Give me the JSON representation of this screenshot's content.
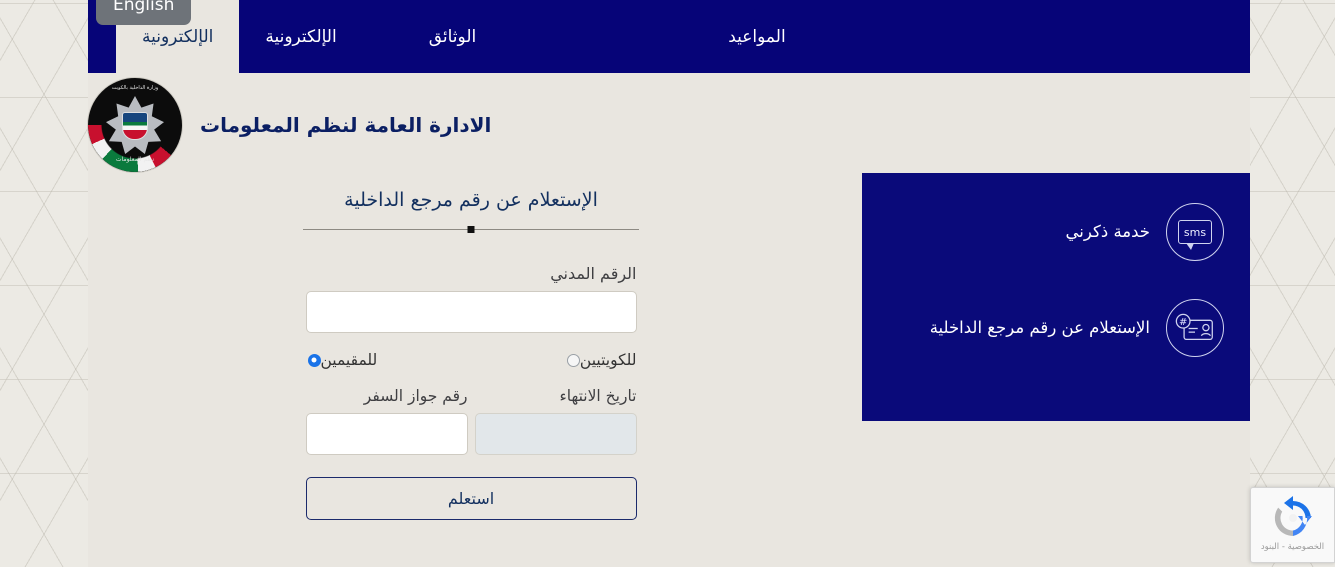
{
  "navbar": {
    "lang_button": "English",
    "items": [
      {
        "label": "الإلكترونية",
        "active": true
      },
      {
        "label": "الإلكترونية",
        "active": false
      },
      {
        "label": "الوثائق",
        "active": false
      },
      {
        "label": "المواعيد",
        "active": false
      }
    ]
  },
  "header": {
    "org_title": "الادارة العامة لنظم المعلومات",
    "emblem_top_text": "وزارة الداخلية بالكويت",
    "emblem_bottom_text": "نظم المعلومات"
  },
  "side_panel": {
    "services": [
      {
        "label": "خدمة ذكرني",
        "icon": "sms-icon",
        "icon_text": "sms"
      },
      {
        "label": "الإستعلام عن رقم مرجع الداخلية",
        "icon": "id-card-hash-icon",
        "icon_text": ""
      }
    ]
  },
  "form": {
    "title": "الإستعلام عن رقم مرجع الداخلية",
    "civil_number": {
      "label": "الرقم المدني",
      "value": "",
      "placeholder": ""
    },
    "radios": [
      {
        "label": "للكويتيين",
        "selected": false
      },
      {
        "label": "للمقيمين",
        "selected": true
      }
    ],
    "passport_number": {
      "label": "رقم جواز السفر",
      "value": "",
      "placeholder": ""
    },
    "expiry_date": {
      "label": "تاريخ الانتهاء",
      "value": "",
      "placeholder": "",
      "disabled": true
    },
    "submit_label": "استعلم"
  },
  "recaptcha": {
    "links": "الخصوصية - البنود"
  },
  "colors": {
    "navy": "#060478",
    "panel_blue": "#0a0a7a",
    "beige": "#e9e6e0",
    "title_navy": "#13305f",
    "radio_blue": "#1a73e8",
    "lang_gray": "#6e7379"
  }
}
